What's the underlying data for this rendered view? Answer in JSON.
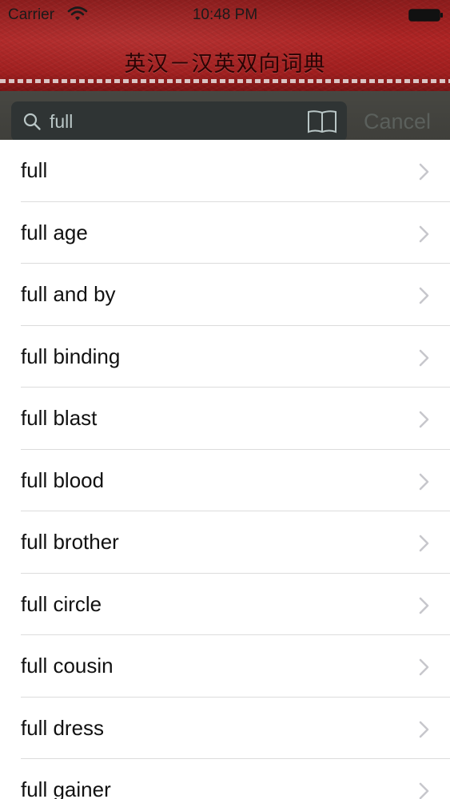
{
  "status_bar": {
    "carrier": "Carrier",
    "time": "10:48 PM"
  },
  "header": {
    "title": "英汉－汉英双向词典"
  },
  "search": {
    "value": "full",
    "cancel_label": "Cancel"
  },
  "results": [
    {
      "label": "full"
    },
    {
      "label": "full age"
    },
    {
      "label": "full and by"
    },
    {
      "label": "full binding"
    },
    {
      "label": "full blast"
    },
    {
      "label": "full blood"
    },
    {
      "label": "full brother"
    },
    {
      "label": "full circle"
    },
    {
      "label": "full cousin"
    },
    {
      "label": "full dress"
    },
    {
      "label": "full gainer"
    }
  ],
  "colors": {
    "header_red": "#a11f1f",
    "search_bar_bg": "#474742",
    "search_field_bg": "#2f3434",
    "cancel_text": "#5b605c",
    "chevron": "#c7c7cc"
  },
  "icons": [
    "wifi-icon",
    "battery-icon",
    "search-icon",
    "bookmarks-icon",
    "chevron-right-icon"
  ]
}
